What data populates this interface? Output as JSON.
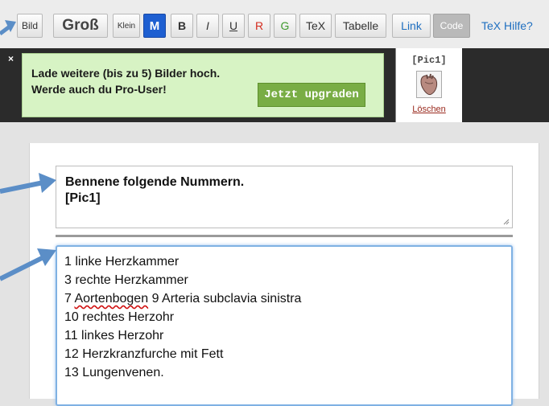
{
  "toolbar": {
    "bild": "Bild",
    "gross": "Groß",
    "klein": "Klein",
    "m": "M",
    "b": "B",
    "i": "I",
    "u": "U",
    "r": "R",
    "g": "G",
    "tex": "TeX",
    "tabelle": "Tabelle",
    "link": "Link",
    "code": "Code",
    "tex_hilfe": "TeX Hilfe?"
  },
  "colors": {
    "m_button_bg": "#1e5fd1",
    "r_text": "#d42b1e",
    "g_text": "#3f9a2e",
    "link_text": "#1f6fc0",
    "promo_bg": "#d7f3c4",
    "upgrade_bg": "#79ad45",
    "arrow": "#5b8ec7"
  },
  "upload": {
    "close": "×",
    "promo_text": "Lade weitere (bis zu 5) Bilder hoch.\nWerde auch du Pro-User!",
    "upgrade_button": "Jetzt upgraden",
    "pic_label": "[Pic1]",
    "pic_delete": "Löschen"
  },
  "question": {
    "lines": [
      "Bennene folgende Nummern.",
      "[Pic1]"
    ]
  },
  "answer": {
    "line1": "1 linke Herzkammer",
    "line2": "3 rechte Herzkammer",
    "line3_a": "7",
    "line3_b": "Aortenbogen",
    "line3_c": "9 Arteria subclavia sinistra",
    "line4": "10 rechtes Herzohr",
    "line5": "11 linkes Herzohr",
    "line6": "12 Herzkranzfurche mit Fett",
    "line7": "13 Lungenvenen."
  }
}
